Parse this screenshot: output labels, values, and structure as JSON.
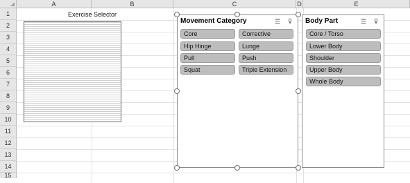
{
  "sheet": {
    "columns": [
      "A",
      "B",
      "C",
      "D",
      "E"
    ],
    "rows": [
      "1",
      "2",
      "3",
      "4",
      "5",
      "6",
      "7",
      "8",
      "9",
      "10",
      "11",
      "12",
      "13",
      "14",
      "15"
    ]
  },
  "title": "Exercise Selector",
  "movement_slicer": {
    "header": "Movement Category",
    "items": [
      "Core",
      "Corrective",
      "Hip Hinge",
      "Lunge",
      "Pull",
      "Push",
      "Squat",
      "Triple Extension"
    ],
    "multi_select_icon": "multi-select-icon",
    "clear_filter_icon": "clear-filter-icon"
  },
  "bodypart_slicer": {
    "header": "Body Part",
    "items": [
      "Core / Torso",
      "Lower Body",
      "Shoulder",
      "Upper Body",
      "Whole Body"
    ],
    "multi_select_icon": "multi-select-icon",
    "clear_filter_icon": "clear-filter-icon"
  },
  "colors": {
    "item_fill": "#bdbdbd",
    "header_fill": "#e6e6e6",
    "border": "#8a8a8a"
  }
}
